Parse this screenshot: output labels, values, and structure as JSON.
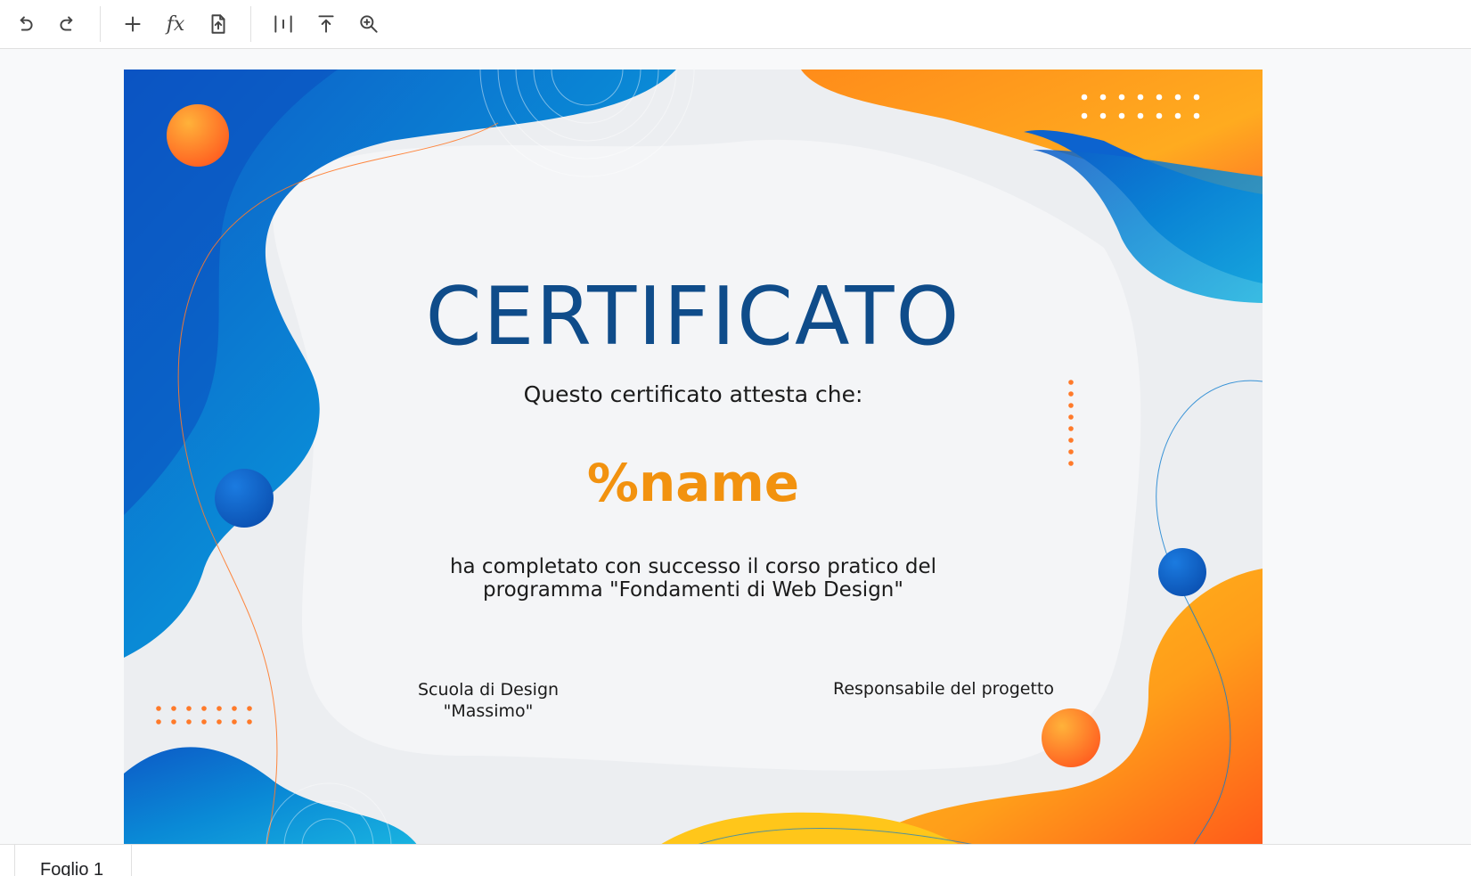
{
  "toolbar": {
    "buttons": [
      {
        "name": "undo-icon"
      },
      {
        "name": "redo-icon"
      },
      {
        "name": "add-icon"
      },
      {
        "name": "function-icon"
      },
      {
        "name": "upload-file-icon"
      },
      {
        "name": "column-split-icon"
      },
      {
        "name": "align-top-icon"
      },
      {
        "name": "zoom-in-icon"
      }
    ]
  },
  "certificate": {
    "title": "CERTIFICATO",
    "subtitle": "Questo certificato attesta che:",
    "name_placeholder": "%name",
    "body_line1": "ha completato con successo il corso pratico del",
    "body_line2": "programma \"Fondamenti di Web Design\"",
    "signature_left_line1": "Scuola di Design",
    "signature_left_line2": "\"Massimo\"",
    "signature_right": "Responsabile del progetto"
  },
  "colors": {
    "title": "#0f4c8a",
    "name": "#f2920f",
    "blue_accent": "#0a6fd1",
    "orange_accent": "#ff8a1a"
  },
  "sheets": {
    "tabs": [
      "Foglio 1"
    ]
  }
}
